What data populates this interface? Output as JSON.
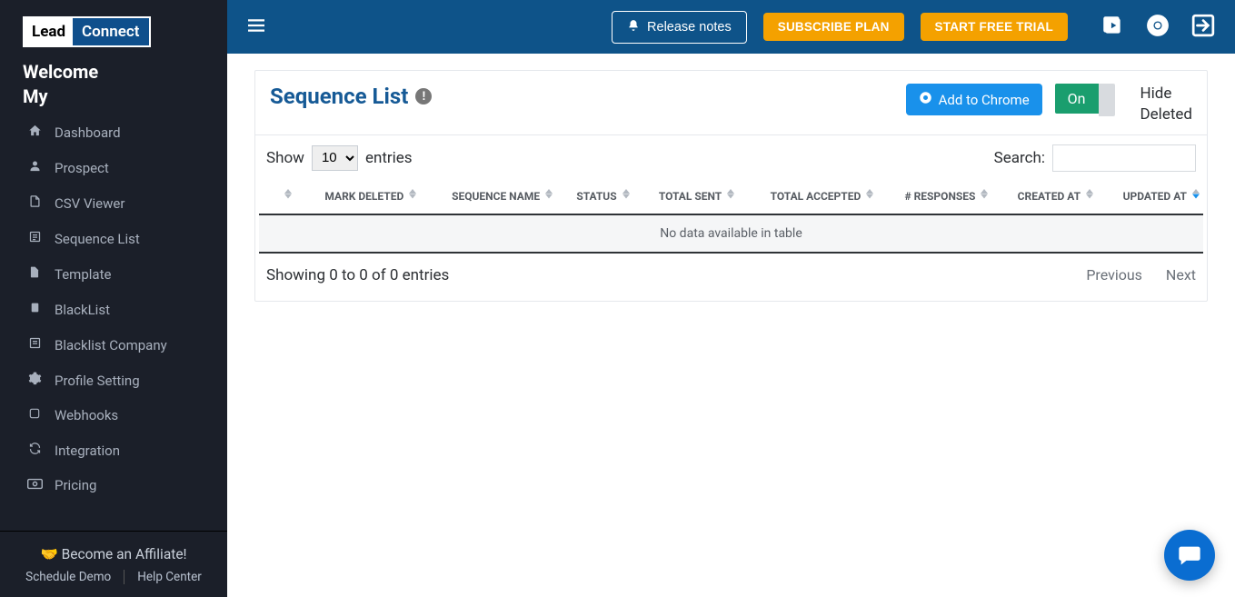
{
  "logo": {
    "left": "Lead",
    "right": "Connect"
  },
  "welcome": {
    "line1": "Welcome",
    "line2": "My"
  },
  "sidebar": {
    "items": [
      {
        "label": "Dashboard"
      },
      {
        "label": "Prospect"
      },
      {
        "label": "CSV Viewer"
      },
      {
        "label": "Sequence List"
      },
      {
        "label": "Template"
      },
      {
        "label": "BlackList"
      },
      {
        "label": "Blacklist Company"
      },
      {
        "label": "Profile Setting"
      },
      {
        "label": "Webhooks"
      },
      {
        "label": "Integration"
      },
      {
        "label": "Pricing"
      }
    ],
    "affiliate": "Become an Affiliate!",
    "schedule_demo": "Schedule Demo",
    "help_center": "Help Center"
  },
  "topbar": {
    "release_notes": "Release notes",
    "subscribe_plan": "SUBSCRIBE PLAN",
    "start_free_trial": "START FREE TRIAL"
  },
  "page": {
    "title": "Sequence List",
    "add_to_chrome": "Add to Chrome",
    "toggle_on": "On",
    "hide_deleted": "Hide Deleted"
  },
  "table": {
    "show_label": "Show",
    "entries_label": "entries",
    "entries_value": "10",
    "search_label": "Search:",
    "columns": {
      "mark_deleted": "MARK DELETED",
      "sequence_name": "SEQUENCE NAME",
      "status": "STATUS",
      "total_sent": "TOTAL SENT",
      "total_accepted": "TOTAL ACCEPTED",
      "responses": "# RESPONSES",
      "created_at": "CREATED AT",
      "updated_at": "UPDATED AT"
    },
    "no_data": "No data available in table",
    "footer_info": "Showing 0 to 0 of 0 entries",
    "prev": "Previous",
    "next": "Next"
  }
}
